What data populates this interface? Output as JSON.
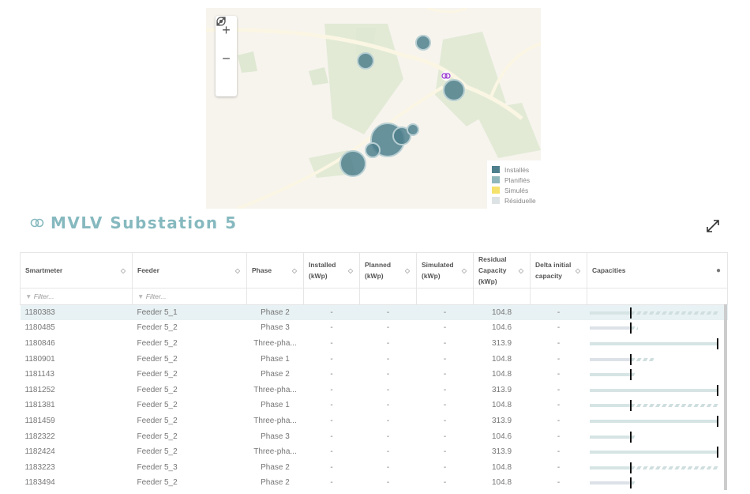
{
  "map": {
    "controls": [
      "zoom-in",
      "zoom-out",
      "locate",
      "fullscreen"
    ],
    "legend": [
      {
        "label": "Installés",
        "color": "#4e7f8c"
      },
      {
        "label": "Planifiés",
        "color": "#8fb7bb"
      },
      {
        "label": "Simulés",
        "color": "#f5e26a"
      },
      {
        "label": "Résiduelle",
        "color": "#dde3e4"
      }
    ]
  },
  "title": "MVLV Substation 5",
  "table": {
    "columns": [
      "Smartmeter",
      "Feeder",
      "Phase",
      "Installed (kWp)",
      "Planned (kWp)",
      "Simulated (kWp)",
      "Residual Capacity (kWp)",
      "Delta initial capacity",
      "Capacities"
    ],
    "filter_placeholder": "Filter...",
    "rows": [
      {
        "smartmeter": "1180383",
        "feeder": "Feeder 5_1",
        "phase": "Phase 2",
        "installed": "-",
        "planned": "-",
        "simulated": "-",
        "residual": "104.8",
        "delta": "-",
        "selected": true
      },
      {
        "smartmeter": "1180485",
        "feeder": "Feeder 5_2",
        "phase": "Phase 3",
        "installed": "-",
        "planned": "-",
        "simulated": "-",
        "residual": "104.6",
        "delta": "-"
      },
      {
        "smartmeter": "1180846",
        "feeder": "Feeder 5_2",
        "phase": "Three-pha...",
        "installed": "-",
        "planned": "-",
        "simulated": "-",
        "residual": "313.9",
        "delta": "-"
      },
      {
        "smartmeter": "1180901",
        "feeder": "Feeder 5_2",
        "phase": "Phase 1",
        "installed": "-",
        "planned": "-",
        "simulated": "-",
        "residual": "104.8",
        "delta": "-"
      },
      {
        "smartmeter": "1181143",
        "feeder": "Feeder 5_2",
        "phase": "Phase 2",
        "installed": "-",
        "planned": "-",
        "simulated": "-",
        "residual": "104.8",
        "delta": "-"
      },
      {
        "smartmeter": "1181252",
        "feeder": "Feeder 5_2",
        "phase": "Three-pha...",
        "installed": "-",
        "planned": "-",
        "simulated": "-",
        "residual": "313.9",
        "delta": "-"
      },
      {
        "smartmeter": "1181381",
        "feeder": "Feeder 5_2",
        "phase": "Phase 1",
        "installed": "-",
        "planned": "-",
        "simulated": "-",
        "residual": "104.8",
        "delta": "-"
      },
      {
        "smartmeter": "1181459",
        "feeder": "Feeder 5_2",
        "phase": "Three-pha...",
        "installed": "-",
        "planned": "-",
        "simulated": "-",
        "residual": "313.9",
        "delta": "-"
      },
      {
        "smartmeter": "1182322",
        "feeder": "Feeder 5_2",
        "phase": "Phase 3",
        "installed": "-",
        "planned": "-",
        "simulated": "-",
        "residual": "104.6",
        "delta": "-"
      },
      {
        "smartmeter": "1182424",
        "feeder": "Feeder 5_2",
        "phase": "Three-pha...",
        "installed": "-",
        "planned": "-",
        "simulated": "-",
        "residual": "313.9",
        "delta": "-"
      },
      {
        "smartmeter": "1183223",
        "feeder": "Feeder 5_3",
        "phase": "Phase 2",
        "installed": "-",
        "planned": "-",
        "simulated": "-",
        "residual": "104.8",
        "delta": "-"
      },
      {
        "smartmeter": "1183494",
        "feeder": "Feeder 5_2",
        "phase": "Phase 2",
        "installed": "-",
        "planned": "-",
        "simulated": "-",
        "residual": "104.8",
        "delta": "-"
      }
    ]
  }
}
